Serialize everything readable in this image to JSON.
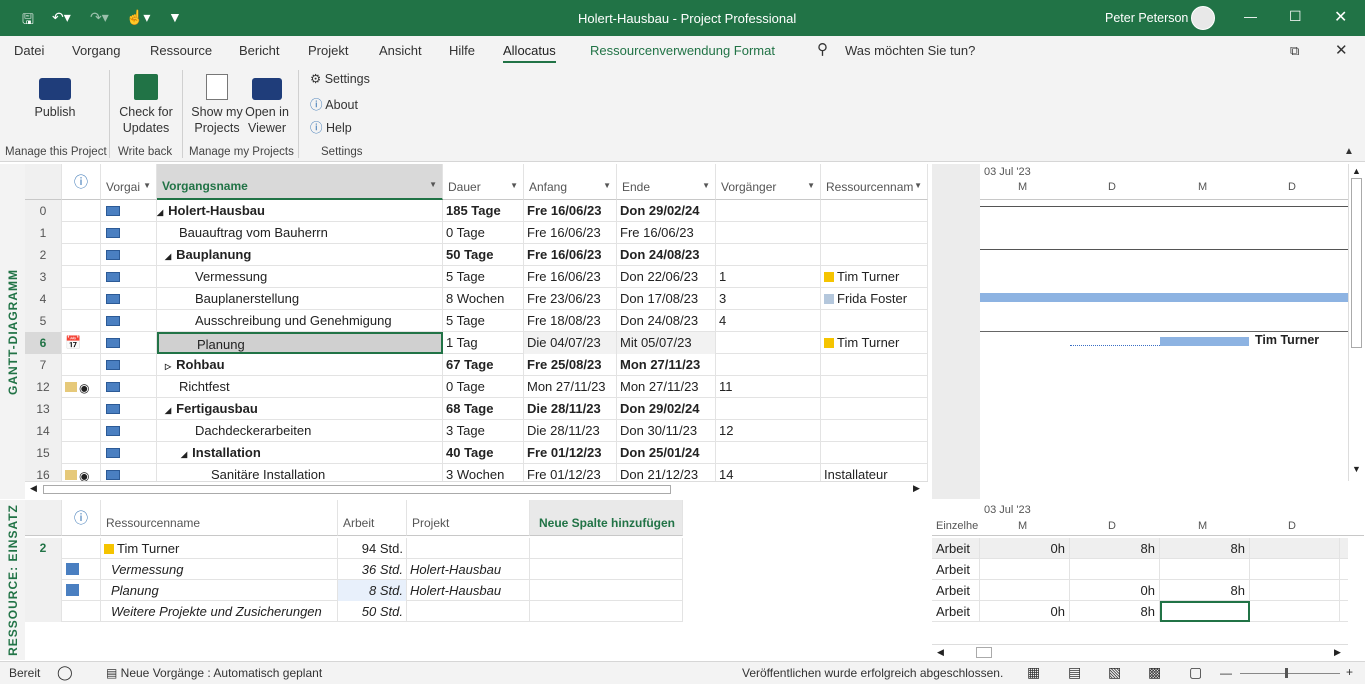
{
  "window": {
    "title": "Holert-Hausbau  -  Project Professional",
    "user": "Peter Peterson"
  },
  "menu": {
    "tabs": [
      "Datei",
      "Vorgang",
      "Ressource",
      "Bericht",
      "Projekt",
      "Ansicht",
      "Hilfe",
      "Allocatus",
      "Ressourcenverwendung Format"
    ],
    "search": "Was möchten Sie tun?"
  },
  "ribbon": {
    "publish": "Publish",
    "check": "Check for Updates",
    "show": "Show my Projects",
    "open": "Open in Viewer",
    "settings": "Settings",
    "about": "About",
    "help": "Help",
    "groups": [
      "Manage this Project",
      "Write back",
      "Manage my Projects",
      "Settings"
    ]
  },
  "views": {
    "top": "GANTT-DIAGRAMM",
    "bottom": "RESSOURCE: EINSATZ"
  },
  "gantt": {
    "headers": [
      "Vorgai",
      "Vorgangsname",
      "Dauer",
      "Anfang",
      "Ende",
      "Vorgänger",
      "Ressourcennam"
    ],
    "rows": [
      {
        "id": "0",
        "name": "Holert-Hausbau",
        "dur": "185 Tage",
        "start": "Fre 16/06/23",
        "end": "Don 29/02/24",
        "pred": "",
        "res": "",
        "lvl": 0,
        "sum": "open",
        "bold": true
      },
      {
        "id": "1",
        "name": "Bauauftrag vom Bauherrn",
        "dur": "0 Tage",
        "start": "Fre 16/06/23",
        "end": "Fre 16/06/23",
        "pred": "",
        "res": "",
        "lvl": 1
      },
      {
        "id": "2",
        "name": "Bauplanung",
        "dur": "50 Tage",
        "start": "Fre 16/06/23",
        "end": "Don 24/08/23",
        "pred": "",
        "res": "",
        "lvl": 1,
        "sum": "open",
        "bold": true
      },
      {
        "id": "3",
        "name": "Vermessung",
        "dur": "5 Tage",
        "start": "Fre 16/06/23",
        "end": "Don 22/06/23",
        "pred": "1",
        "res": "Tim Turner",
        "lvl": 2,
        "rc": "#f5c400"
      },
      {
        "id": "4",
        "name": "Bauplanerstellung",
        "dur": "8 Wochen",
        "start": "Fre 23/06/23",
        "end": "Don 17/08/23",
        "pred": "3",
        "res": "Frida Foster",
        "lvl": 2,
        "rc": "#b4c7dc"
      },
      {
        "id": "5",
        "name": "Ausschreibung und Genehmigung",
        "dur": "5 Tage",
        "start": "Fre 18/08/23",
        "end": "Don 24/08/23",
        "pred": "4",
        "res": "",
        "lvl": 2
      },
      {
        "id": "6",
        "name": "Planung",
        "dur": "1 Tag",
        "start": "Die 04/07/23",
        "end": "Mit 05/07/23",
        "pred": "",
        "res": "Tim Turner",
        "lvl": 2,
        "rc": "#f5c400",
        "sel": true
      },
      {
        "id": "7",
        "name": "Rohbau",
        "dur": "67 Tage",
        "start": "Fre 25/08/23",
        "end": "Mon 27/11/23",
        "pred": "",
        "res": "",
        "lvl": 1,
        "sum": "closed",
        "bold": true
      },
      {
        "id": "12",
        "name": "Richtfest",
        "dur": "0 Tage",
        "start": "Mon 27/11/23",
        "end": "Mon 27/11/23",
        "pred": "11",
        "res": "",
        "lvl": 1,
        "note": true
      },
      {
        "id": "13",
        "name": "Fertigausbau",
        "dur": "68 Tage",
        "start": "Die 28/11/23",
        "end": "Don 29/02/24",
        "pred": "",
        "res": "",
        "lvl": 1,
        "sum": "open",
        "bold": true
      },
      {
        "id": "14",
        "name": "Dachdeckerarbeiten",
        "dur": "3 Tage",
        "start": "Die 28/11/23",
        "end": "Don 30/11/23",
        "pred": "12",
        "res": "",
        "lvl": 2
      },
      {
        "id": "15",
        "name": "Installation",
        "dur": "40 Tage",
        "start": "Fre 01/12/23",
        "end": "Don 25/01/24",
        "pred": "",
        "res": "",
        "lvl": 2,
        "sum": "open",
        "bold": true
      },
      {
        "id": "16",
        "name": "Sanitäre Installation",
        "dur": "3 Wochen",
        "start": "Fre 01/12/23",
        "end": "Don 21/12/23",
        "pred": "14",
        "res": "Installateur",
        "lvl": 3,
        "note": true
      }
    ]
  },
  "timescale": {
    "week": "03 Jul '23",
    "days": [
      "M",
      "D",
      "M",
      "D"
    ]
  },
  "bar_label": "Tim Turner",
  "usage": {
    "headers": [
      "Ressourcenname",
      "Arbeit",
      "Projekt",
      "Neue Spalte hinzufügen"
    ],
    "rows": [
      {
        "id": "2",
        "name": "Tim Turner",
        "work": "94 Std.",
        "proj": ""
      },
      {
        "id": "",
        "name": "Vermessung",
        "work": "36 Std.",
        "proj": "Holert-Hausbau"
      },
      {
        "id": "",
        "name": "Planung",
        "work": "8 Std.",
        "proj": "Holert-Hausbau"
      },
      {
        "id": "",
        "name": "Weitere Projekte und Zusicherungen",
        "work": "50 Std.",
        "proj": ""
      }
    ],
    "grid_header": "Einzelhe",
    "grid_label": "Arbeit",
    "grid": [
      [
        "0h",
        "8h",
        "8h",
        ""
      ],
      [
        "",
        "",
        "",
        ""
      ],
      [
        "",
        "0h",
        "8h",
        ""
      ],
      [
        "0h",
        "8h",
        "",
        ""
      ]
    ]
  },
  "status": {
    "ready": "Bereit",
    "mode": "Neue Vorgänge : Automatisch geplant",
    "msg": "Veröffentlichen wurde erfolgreich abgeschlossen."
  }
}
